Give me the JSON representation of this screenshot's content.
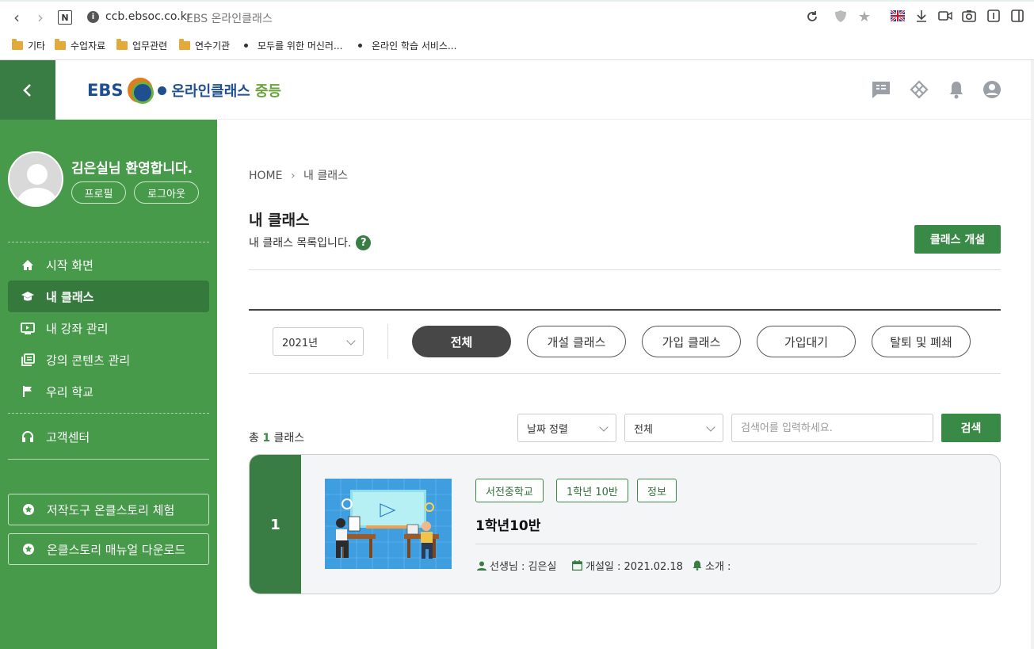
{
  "browser": {
    "url": "ccb.ebsoc.co.kr",
    "page_title": "EBS 온라인클래스",
    "bookmarks": [
      "기타",
      "수업자료",
      "업무관련",
      "연수기관",
      "모두를 위한 머신러...",
      "온라인 학습 서비스..."
    ]
  },
  "header": {
    "logo_ebs": "EBS",
    "logo_text": "온라인클래스",
    "logo_level": "중등"
  },
  "sidebar": {
    "user_name": "김은실",
    "welcome_suffix": "님 환영합니다.",
    "profile_label": "프로필",
    "logout_label": "로그아웃",
    "menu": [
      "시작 화면",
      "내 클래스",
      "내 강좌 관리",
      "강의 콘텐츠 관리",
      "우리 학교"
    ],
    "support": "고객센터",
    "tools": [
      "저작도구 온클스토리 체험",
      "온클스토리 매뉴얼 다운로드"
    ]
  },
  "main": {
    "breadcrumb_home": "HOME",
    "breadcrumb_sep": "›",
    "breadcrumb_current": "내 클래스",
    "title": "내 클래스",
    "description": "내 클래스 목록입니다.",
    "help": "?",
    "create_button": "클래스 개설",
    "year": "2021년",
    "tabs": [
      "전체",
      "개설 클래스",
      "가입 클래스",
      "가입대기",
      "탈퇴 및 폐쇄"
    ],
    "total_prefix": "총",
    "total_count": "1",
    "total_suffix": "클래스",
    "sort_select": "날짜 정렬",
    "filter_select": "전체",
    "search_placeholder": "검색어를 입력하세요.",
    "search_button": "검색"
  },
  "class_card": {
    "number": "1",
    "tags": [
      "서전중학교",
      "1학년 10반",
      "정보"
    ],
    "title": "1학년10반",
    "teacher": "선생님 : 김은실",
    "opened": "개설일 : 2021.02.18",
    "intro": "소개 :"
  },
  "colors": {
    "sidebar": "#479a4a",
    "accent": "#3a8a47",
    "dark_green": "#3a7d44",
    "active_tab": "#474747"
  }
}
